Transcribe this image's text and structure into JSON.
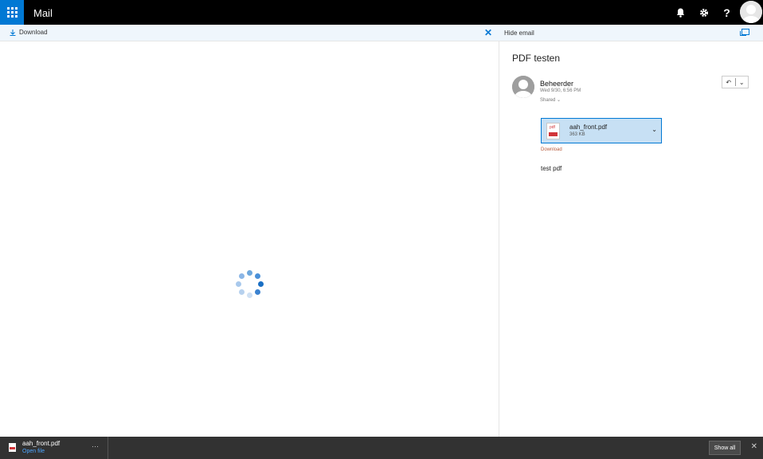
{
  "header": {
    "app_title": "Mail",
    "icons": [
      "app-launcher-icon",
      "bell-icon",
      "gear-icon",
      "help-icon",
      "user-avatar"
    ],
    "help_glyph": "?"
  },
  "commandbar": {
    "download_label": "Download",
    "close_glyph": "✕",
    "hide_email_label": "Hide email"
  },
  "email": {
    "subject": "PDF testen",
    "sender": "Beheerder",
    "date": "Wed 9/30, 6:56 PM",
    "shared": "Shared",
    "attachment": {
      "name": "aah_front.pdf",
      "size": "363 KB",
      "type_tag": "pdf",
      "download_label": "Download"
    },
    "body": "test pdf"
  },
  "download_bar": {
    "file_name": "aah_front.pdf",
    "open_label": "Open file",
    "more_glyph": "···",
    "show_all_label": "Show all",
    "close_glyph": "✕"
  },
  "colors": {
    "accent": "#0078d4",
    "topbar": "#000000",
    "download_bar": "#323232",
    "attachment_bg": "#c7e0f4"
  }
}
